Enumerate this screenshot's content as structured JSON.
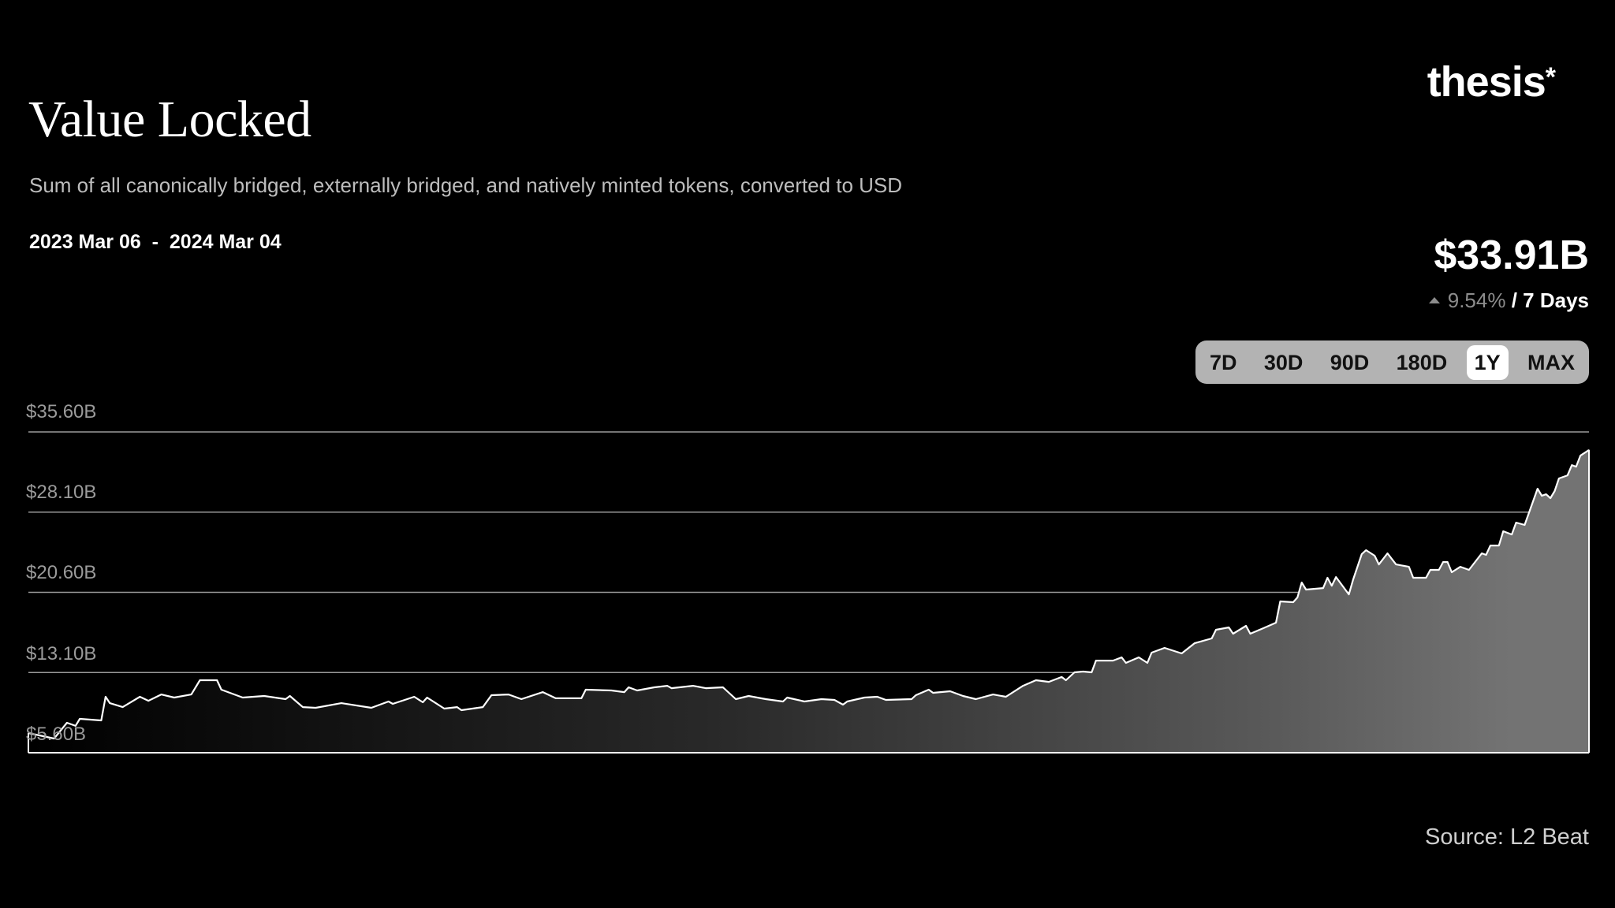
{
  "header": {
    "title": "Value Locked",
    "subtitle": "Sum of all canonically bridged, externally bridged, and natively minted tokens,  converted to USD",
    "date_range": "2023 Mar 06  -  2024 Mar 04",
    "logo_text": "thesis",
    "logo_mark": "*"
  },
  "summary": {
    "value": "$33.91B",
    "change_icon": "triangle-up-icon",
    "change_pct": "9.54%",
    "change_period": "/ 7 Days"
  },
  "range_selector": {
    "options": [
      "7D",
      "30D",
      "90D",
      "180D",
      "1Y",
      "MAX"
    ],
    "selected": "1Y"
  },
  "source": "Source: L2 Beat",
  "colors": {
    "background": "#000000",
    "line": "#ffffff",
    "fill_start": "#000000",
    "fill_end": "#737373",
    "gridline": "#9a9a9a",
    "button_bg": "#b3b3b3"
  },
  "chart_data": {
    "type": "area",
    "title": "Value Locked",
    "xlabel": "",
    "ylabel": "",
    "xlim": [
      "2023-03-06",
      "2024-03-04"
    ],
    "ylim": [
      5.6,
      35.6
    ],
    "y_unit": "USD billions",
    "y_ticks": [
      5.6,
      13.1,
      20.6,
      28.1,
      35.6
    ],
    "y_tick_labels": [
      "$5.60B",
      "$13.10B",
      "$20.60B",
      "$28.10B",
      "$35.60B"
    ],
    "grid": "horizontal",
    "legend": "none",
    "points": [
      [
        "2023-03-06",
        7.44
      ],
      [
        "2023-03-12",
        6.93
      ],
      [
        "2023-03-15",
        8.4
      ],
      [
        "2023-03-17",
        8.11
      ],
      [
        "2023-03-18",
        8.77
      ],
      [
        "2023-03-23",
        8.62
      ],
      [
        "2023-03-24",
        10.83
      ],
      [
        "2023-03-25",
        10.24
      ],
      [
        "2023-03-28",
        9.87
      ],
      [
        "2023-04-01",
        10.83
      ],
      [
        "2023-04-03",
        10.46
      ],
      [
        "2023-04-06",
        11.05
      ],
      [
        "2023-04-09",
        10.76
      ],
      [
        "2023-04-13",
        11.05
      ],
      [
        "2023-04-15",
        12.38
      ],
      [
        "2023-04-19",
        12.38
      ],
      [
        "2023-04-20",
        11.5
      ],
      [
        "2023-04-25",
        10.76
      ],
      [
        "2023-04-30",
        10.91
      ],
      [
        "2023-05-05",
        10.61
      ],
      [
        "2023-05-06",
        10.91
      ],
      [
        "2023-05-09",
        9.87
      ],
      [
        "2023-05-12",
        9.8
      ],
      [
        "2023-05-18",
        10.24
      ],
      [
        "2023-05-25",
        9.8
      ],
      [
        "2023-05-29",
        10.39
      ],
      [
        "2023-05-30",
        10.17
      ],
      [
        "2023-06-04",
        10.83
      ],
      [
        "2023-06-06",
        10.32
      ],
      [
        "2023-06-07",
        10.76
      ],
      [
        "2023-06-11",
        9.73
      ],
      [
        "2023-06-14",
        9.87
      ],
      [
        "2023-06-15",
        9.58
      ],
      [
        "2023-06-20",
        9.87
      ],
      [
        "2023-06-22",
        10.98
      ],
      [
        "2023-06-26",
        11.05
      ],
      [
        "2023-06-29",
        10.61
      ],
      [
        "2023-07-04",
        11.27
      ],
      [
        "2023-07-07",
        10.69
      ],
      [
        "2023-07-13",
        10.69
      ],
      [
        "2023-07-14",
        11.5
      ],
      [
        "2023-07-20",
        11.42
      ],
      [
        "2023-07-23",
        11.27
      ],
      [
        "2023-07-24",
        11.72
      ],
      [
        "2023-07-26",
        11.42
      ],
      [
        "2023-07-30",
        11.72
      ],
      [
        "2023-08-02",
        11.86
      ],
      [
        "2023-08-03",
        11.64
      ],
      [
        "2023-08-08",
        11.86
      ],
      [
        "2023-08-11",
        11.64
      ],
      [
        "2023-08-15",
        11.72
      ],
      [
        "2023-08-18",
        10.61
      ],
      [
        "2023-08-21",
        10.91
      ],
      [
        "2023-08-25",
        10.61
      ],
      [
        "2023-08-29",
        10.39
      ],
      [
        "2023-08-30",
        10.76
      ],
      [
        "2023-09-03",
        10.39
      ],
      [
        "2023-09-07",
        10.61
      ],
      [
        "2023-09-10",
        10.54
      ],
      [
        "2023-09-12",
        10.1
      ],
      [
        "2023-09-13",
        10.39
      ],
      [
        "2023-09-17",
        10.76
      ],
      [
        "2023-09-20",
        10.83
      ],
      [
        "2023-09-22",
        10.54
      ],
      [
        "2023-09-28",
        10.61
      ],
      [
        "2023-09-29",
        10.98
      ],
      [
        "2023-10-02",
        11.5
      ],
      [
        "2023-10-03",
        11.2
      ],
      [
        "2023-10-07",
        11.35
      ],
      [
        "2023-10-10",
        10.91
      ],
      [
        "2023-10-13",
        10.61
      ],
      [
        "2023-10-17",
        11.05
      ],
      [
        "2023-10-20",
        10.83
      ],
      [
        "2023-10-24",
        11.86
      ],
      [
        "2023-10-27",
        12.38
      ],
      [
        "2023-10-30",
        12.23
      ],
      [
        "2023-11-02",
        12.68
      ],
      [
        "2023-11-03",
        12.38
      ],
      [
        "2023-11-05",
        13.12
      ],
      [
        "2023-11-07",
        13.19
      ],
      [
        "2023-11-09",
        13.12
      ],
      [
        "2023-11-10",
        14.22
      ],
      [
        "2023-11-14",
        14.22
      ],
      [
        "2023-11-16",
        14.52
      ],
      [
        "2023-11-17",
        14.0
      ],
      [
        "2023-11-20",
        14.52
      ],
      [
        "2023-11-22",
        14.0
      ],
      [
        "2023-11-23",
        14.96
      ],
      [
        "2023-11-26",
        15.4
      ],
      [
        "2023-11-30",
        14.89
      ],
      [
        "2023-12-03",
        15.84
      ],
      [
        "2023-12-07",
        16.29
      ],
      [
        "2023-12-08",
        17.1
      ],
      [
        "2023-12-11",
        17.32
      ],
      [
        "2023-12-12",
        16.73
      ],
      [
        "2023-12-15",
        17.47
      ],
      [
        "2023-12-16",
        16.73
      ],
      [
        "2023-12-19",
        17.24
      ],
      [
        "2023-12-22",
        17.76
      ],
      [
        "2023-12-23",
        19.75
      ],
      [
        "2023-12-26",
        19.68
      ],
      [
        "2023-12-27",
        20.12
      ],
      [
        "2023-12-28",
        21.52
      ],
      [
        "2023-12-29",
        20.86
      ],
      [
        "2024-01-02",
        21.0
      ],
      [
        "2024-01-03",
        21.96
      ],
      [
        "2024-01-04",
        21.22
      ],
      [
        "2024-01-05",
        22.03
      ],
      [
        "2024-01-08",
        20.41
      ],
      [
        "2024-01-09",
        21.81
      ],
      [
        "2024-01-11",
        24.17
      ],
      [
        "2024-01-12",
        24.54
      ],
      [
        "2024-01-14",
        24.03
      ],
      [
        "2024-01-15",
        23.21
      ],
      [
        "2024-01-17",
        24.25
      ],
      [
        "2024-01-19",
        23.21
      ],
      [
        "2024-01-22",
        22.99
      ],
      [
        "2024-01-23",
        21.96
      ],
      [
        "2024-01-26",
        21.96
      ],
      [
        "2024-01-27",
        22.7
      ],
      [
        "2024-01-29",
        22.7
      ],
      [
        "2024-01-30",
        23.44
      ],
      [
        "2024-01-31",
        23.44
      ],
      [
        "2024-02-01",
        22.48
      ],
      [
        "2024-02-03",
        22.99
      ],
      [
        "2024-02-05",
        22.7
      ],
      [
        "2024-02-08",
        24.25
      ],
      [
        "2024-02-09",
        24.1
      ],
      [
        "2024-02-10",
        24.98
      ],
      [
        "2024-02-12",
        24.98
      ],
      [
        "2024-02-13",
        26.31
      ],
      [
        "2024-02-15",
        26.01
      ],
      [
        "2024-02-16",
        27.12
      ],
      [
        "2024-02-18",
        26.9
      ],
      [
        "2024-02-21",
        30.29
      ],
      [
        "2024-02-22",
        29.63
      ],
      [
        "2024-02-23",
        29.77
      ],
      [
        "2024-02-24",
        29.41
      ],
      [
        "2024-02-25",
        30.07
      ],
      [
        "2024-02-26",
        31.25
      ],
      [
        "2024-02-28",
        31.54
      ],
      [
        "2024-02-29",
        32.5
      ],
      [
        "2024-03-01",
        32.35
      ],
      [
        "2024-03-02",
        33.38
      ],
      [
        "2024-03-04",
        33.91
      ]
    ]
  }
}
